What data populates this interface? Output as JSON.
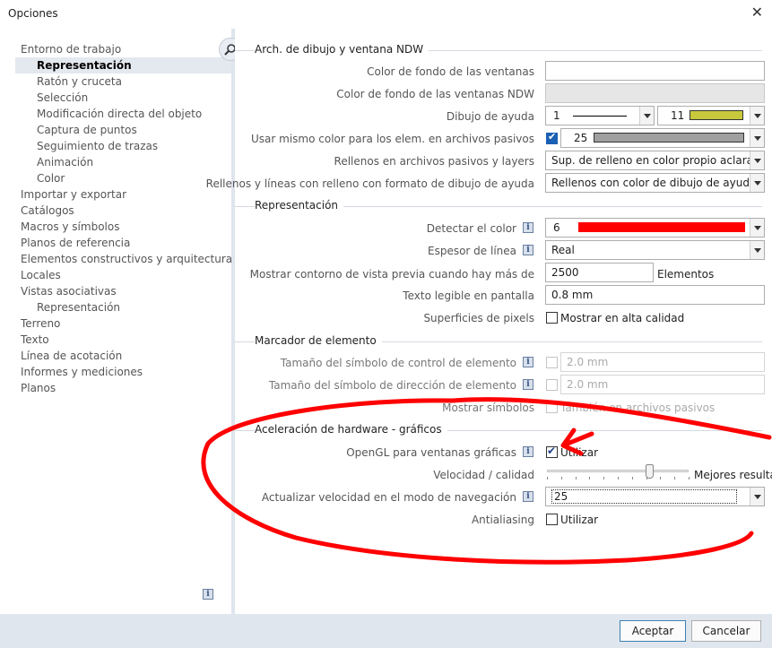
{
  "window": {
    "title": "Opciones"
  },
  "tree": [
    {
      "label": "Entorno de trabajo",
      "level": 0
    },
    {
      "label": "Representación",
      "level": 1,
      "selected": true
    },
    {
      "label": "Ratón y cruceta",
      "level": 1
    },
    {
      "label": "Selección",
      "level": 1
    },
    {
      "label": "Modificación directa del objeto",
      "level": 1
    },
    {
      "label": "Captura de puntos",
      "level": 1
    },
    {
      "label": "Seguimiento de trazas",
      "level": 1
    },
    {
      "label": "Animación",
      "level": 1
    },
    {
      "label": "Color",
      "level": 1
    },
    {
      "label": "Importar y exportar",
      "level": 0
    },
    {
      "label": "Catálogos",
      "level": 0
    },
    {
      "label": "Macros y símbolos",
      "level": 0
    },
    {
      "label": "Planos de referencia",
      "level": 0
    },
    {
      "label": "Elementos constructivos y arquitectura",
      "level": 0
    },
    {
      "label": "Locales",
      "level": 0
    },
    {
      "label": "Vistas asociativas",
      "level": 0
    },
    {
      "label": "Representación",
      "level": 1
    },
    {
      "label": "Terreno",
      "level": 0
    },
    {
      "label": "Texto",
      "level": 0
    },
    {
      "label": "Línea de acotación",
      "level": 0
    },
    {
      "label": "Informes y mediciones",
      "level": 0
    },
    {
      "label": "Planos",
      "level": 0
    }
  ],
  "sections": {
    "s1": "Arch. de dibujo y ventana NDW",
    "s2": "Representación",
    "s3": "Marcador de elemento",
    "s4": "Aceleración de hardware - gráficos"
  },
  "labels": {
    "bg_color": "Color de fondo de las ventanas",
    "bg_color_ndw": "Color de fondo de las ventanas NDW",
    "help_drawing": "Dibujo de ayuda",
    "same_color": "Usar mismo color para los elem. en archivos pasivos",
    "fills_passive": "Rellenos en archivos pasivos y layers",
    "fills_lines": "Rellenos y líneas con relleno con formato de dibujo de ayuda",
    "detect_color": "Detectar el color",
    "line_thickness": "Espesor de línea",
    "preview_outline": "Mostrar contorno de vista previa cuando hay más de",
    "readable_text": "Texto legible en pantalla",
    "pixel_surfaces": "Superficies de pixels",
    "control_symbol_size": "Tamaño del símbolo de control de elemento",
    "direction_symbol_size": "Tamaño del símbolo de dirección de elemento",
    "show_symbols": "Mostrar símbolos",
    "opengl": "OpenGL para ventanas gráficas",
    "speed_quality": "Velocidad / calidad",
    "update_speed": "Actualizar velocidad en el modo de navegación",
    "antialiasing": "Antialiasing"
  },
  "values": {
    "help_line": "1",
    "help_pen": "11",
    "same_color_value": "25",
    "fills_passive_value": "Sup. de relleno en color propio aclarado",
    "fills_lines_value": "Rellenos con color de dibujo de ayuda",
    "detect_color_value": "6",
    "line_thickness_value": "Real",
    "preview_outline_value": "2500",
    "preview_outline_unit": "Elementos",
    "readable_text_value": "0.8 mm",
    "pixel_surfaces_text": "Mostrar en alta calidad",
    "control_symbol_value": "2.0 mm",
    "direction_symbol_value": "2.0 mm",
    "show_symbols_text": "También en archivos pasivos",
    "opengl_text": "Utilizar",
    "slider_right_label": "Mejores resulta",
    "slider_position": 0.72,
    "update_speed_value": "25",
    "antialiasing_text": "Utilizar"
  },
  "colors": {
    "help_pen_swatch": "#c8c83c",
    "same_color_swatch": "#a0a0a0",
    "detect_color_swatch": "#ff0000",
    "annotation": "#ff0000"
  },
  "buttons": {
    "ok": "Aceptar",
    "cancel": "Cancelar"
  },
  "info_icon_glyph": "i"
}
